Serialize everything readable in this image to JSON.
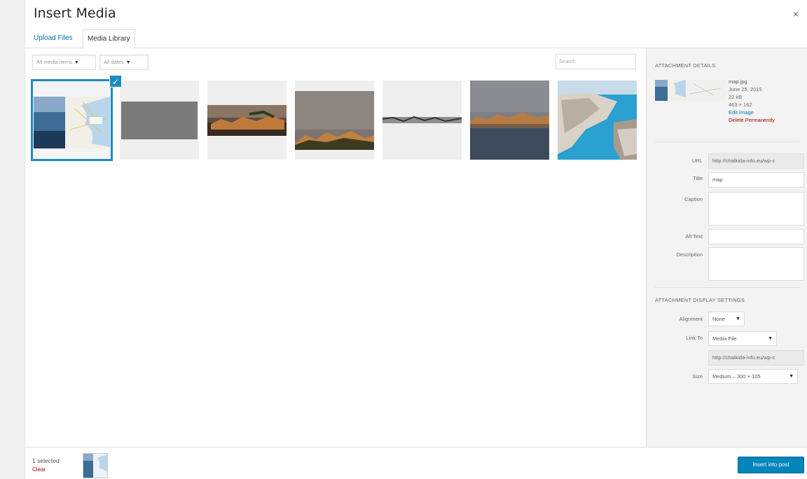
{
  "modal": {
    "title": "Insert Media",
    "close_icon": "×"
  },
  "tabs": [
    {
      "label": "Upload Files"
    },
    {
      "label": "Media Library"
    }
  ],
  "filters": {
    "type": "All media items",
    "date": "All dates"
  },
  "search": {
    "placeholder": "Search"
  },
  "media_items": [
    {
      "name": "map",
      "selected": true
    },
    {
      "name": "gray-image"
    },
    {
      "name": "city-night-wide"
    },
    {
      "name": "city-dusk"
    },
    {
      "name": "panorama-strip"
    },
    {
      "name": "waterfront-evening"
    },
    {
      "name": "coastal-aerial"
    }
  ],
  "details": {
    "heading": "Attachment Details",
    "filename": "map.jpg",
    "date": "June 25, 2015",
    "filesize": "22 kB",
    "dimensions": "463 × 162",
    "edit_link": "Edit Image",
    "delete_link": "Delete Permanently",
    "url_label": "URL",
    "url_value": "http://chalkida-info.eu/wp-c",
    "title_label": "Title",
    "title_value": "map",
    "caption_label": "Caption",
    "alt_label": "Alt Text",
    "description_label": "Description"
  },
  "display_settings": {
    "heading": "Attachment Display Settings",
    "alignment_label": "Alignment",
    "alignment_value": "None",
    "link_label": "Link To",
    "link_value": "Media File",
    "link_url": "http://chalkida-info.eu/wp-c",
    "size_label": "Size",
    "size_value": "Medium – 300 × 105"
  },
  "footer": {
    "selected_text": "1 selected",
    "clear_label": "Clear",
    "insert_label": "Insert into post"
  },
  "colors": {
    "accent": "#0085ba",
    "selected_outline": "#1e8cbe",
    "delete": "#aa0000"
  }
}
